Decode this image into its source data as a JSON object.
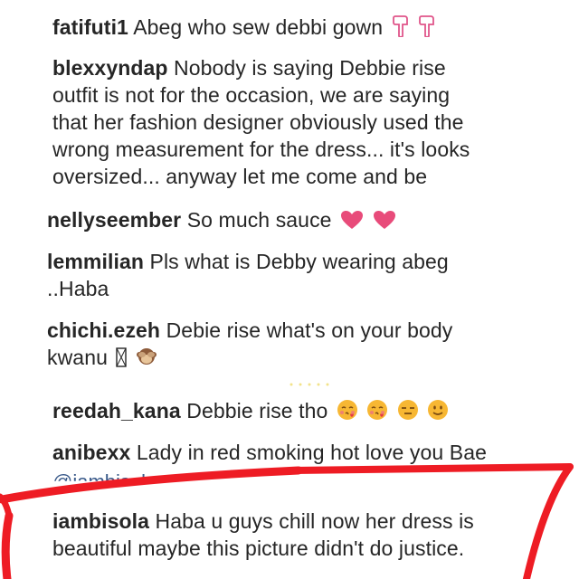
{
  "comments": [
    {
      "user": "fatifuti1",
      "text": "Abeg who sew debbi gown",
      "emoji": [
        "pointing-down-icon",
        "pointing-down-icon"
      ]
    },
    {
      "user": "blexxyndap",
      "text": "Nobody is saying Debbie rise",
      "lines": [
        "outfit is not for the occasion, we are saying",
        "that her fashion designer obviously used the",
        "wrong measurement for the dress... it's looks",
        "oversized... anyway let me come and be"
      ]
    },
    {
      "user": "nellyseember",
      "text": "So much sauce",
      "emoji": [
        "heart-icon",
        "heart-icon"
      ]
    },
    {
      "user": "lemmilian",
      "text": "Pls what is Debby wearing abeg",
      "lines": [
        "..Haba"
      ]
    },
    {
      "user": "chichi.ezeh",
      "text": "Debie rise what's on your body",
      "lines": [
        "kwanu"
      ],
      "emoji": [
        "missing-glyph-icon",
        "see-no-evil-monkey-icon"
      ]
    },
    {
      "user": "reedah_kana",
      "text": "Debbie rise tho",
      "emoji": [
        "kissing-face-icon",
        "kissing-face-icon",
        "expressionless-face-icon",
        "smiling-face-icon"
      ]
    },
    {
      "user": "anibexx",
      "text": "Lady in red smoking hot love you Bae",
      "mention": "@iambisola"
    },
    {
      "user": "iambisola",
      "text": "Haba u guys chill now her dress is",
      "lines": [
        "beautiful maybe this picture didn't do justice."
      ]
    }
  ],
  "colors": {
    "text": "#262626",
    "annotation": "#ee1c24",
    "heart": "#e84b7a",
    "emoji": "#f7b733"
  }
}
